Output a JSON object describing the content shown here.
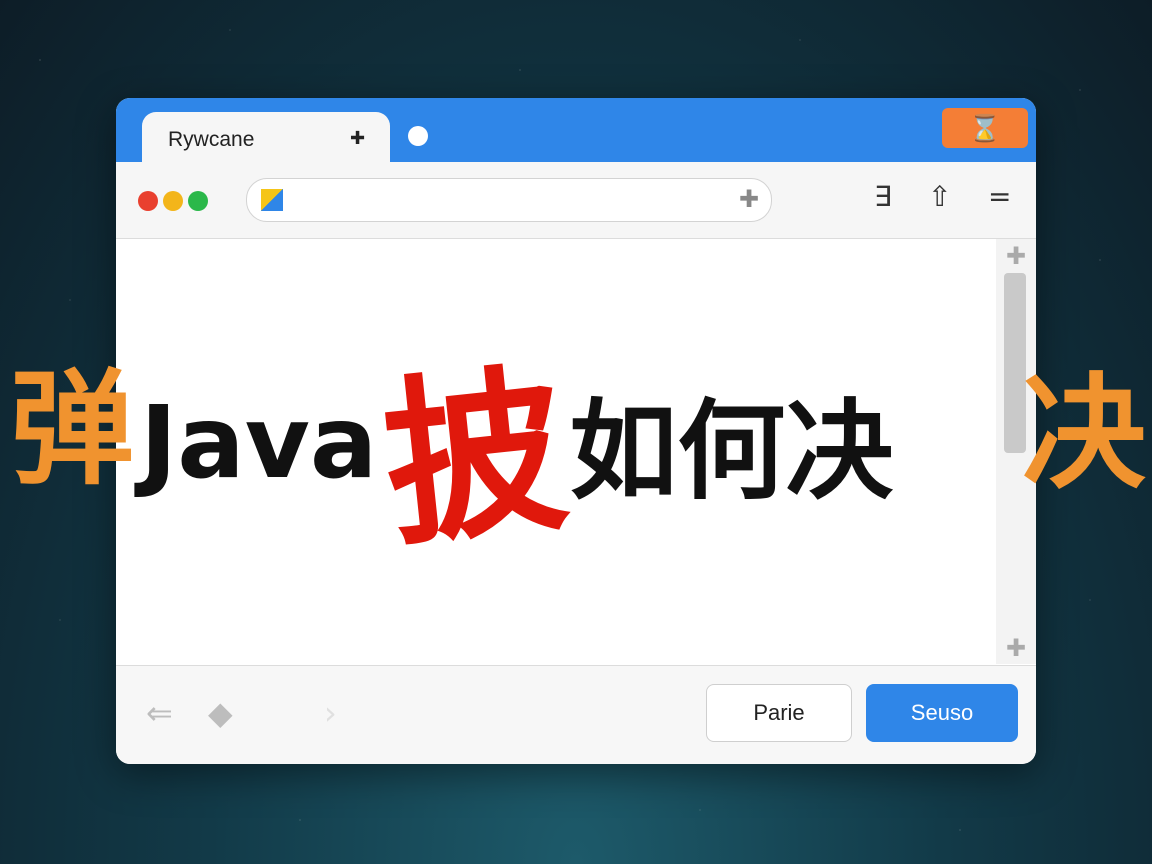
{
  "window": {
    "tab_title": "Rywcane",
    "tab_icon": "puzzle-icon",
    "close_icon": "close-x-icon"
  },
  "toolbar": {
    "address_value": "",
    "address_add_icon": "plus-icon",
    "icons": {
      "list": "∃",
      "home": "⇧",
      "menu": "="
    }
  },
  "content": {
    "headline_java": "Java",
    "headline_red_char": "披",
    "headline_rest": "如何决"
  },
  "overlay": {
    "left_char": "弹",
    "right_char": "决"
  },
  "bottom": {
    "back_glyph": "⇐",
    "home_glyph": "◆",
    "forward_glyph": "›",
    "secondary_label": "Parie",
    "primary_label": "Seuso"
  },
  "colors": {
    "accent": "#2f86e8",
    "close": "#f47e36",
    "headline_red": "#e0180c",
    "overlay_orange": "#f0932f"
  }
}
